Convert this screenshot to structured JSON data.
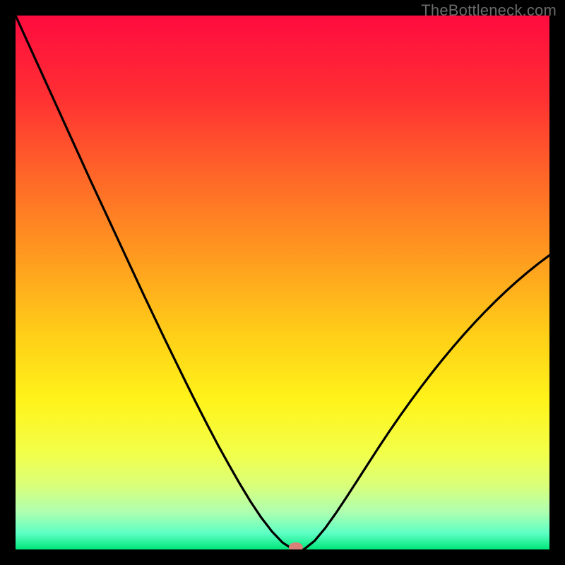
{
  "watermark": "TheBottleneck.com",
  "chart_data": {
    "type": "line",
    "title": "",
    "xlabel": "",
    "ylabel": "",
    "xlim": [
      0,
      100
    ],
    "ylim": [
      0,
      100
    ],
    "x": [
      0,
      2,
      4,
      6,
      8,
      10,
      12,
      14,
      16,
      18,
      20,
      22,
      24,
      26,
      28,
      30,
      32,
      34,
      36,
      38,
      40,
      42,
      44,
      46,
      48,
      50,
      52,
      54,
      56,
      58,
      60,
      62,
      64,
      66,
      68,
      70,
      72,
      74,
      76,
      78,
      80,
      82,
      84,
      86,
      88,
      90,
      92,
      94,
      96,
      98,
      100
    ],
    "values": [
      100,
      95.6,
      91.2,
      86.8,
      82.4,
      78.0,
      73.6,
      69.2,
      64.9,
      60.6,
      56.3,
      52.0,
      47.7,
      43.5,
      39.3,
      35.2,
      31.1,
      27.1,
      23.2,
      19.4,
      15.8,
      12.3,
      9.0,
      6.0,
      3.4,
      1.3,
      0,
      0,
      1.6,
      4.0,
      6.8,
      9.8,
      12.9,
      16.0,
      19.1,
      22.1,
      25.0,
      27.8,
      30.5,
      33.1,
      35.6,
      38.0,
      40.3,
      42.5,
      44.6,
      46.6,
      48.5,
      50.3,
      52.0,
      53.6,
      55.1
    ],
    "marker": {
      "x": 52.5,
      "y": 0
    },
    "gradient_stops": [
      {
        "offset": 0.0,
        "color": "#ff0b3f"
      },
      {
        "offset": 0.15,
        "color": "#ff2f33"
      },
      {
        "offset": 0.3,
        "color": "#ff6628"
      },
      {
        "offset": 0.45,
        "color": "#ff9a1f"
      },
      {
        "offset": 0.6,
        "color": "#ffcf18"
      },
      {
        "offset": 0.72,
        "color": "#fff31a"
      },
      {
        "offset": 0.82,
        "color": "#f2ff4a"
      },
      {
        "offset": 0.88,
        "color": "#daff7a"
      },
      {
        "offset": 0.93,
        "color": "#aeffb0"
      },
      {
        "offset": 0.97,
        "color": "#5cffc4"
      },
      {
        "offset": 1.0,
        "color": "#00e67a"
      }
    ]
  }
}
